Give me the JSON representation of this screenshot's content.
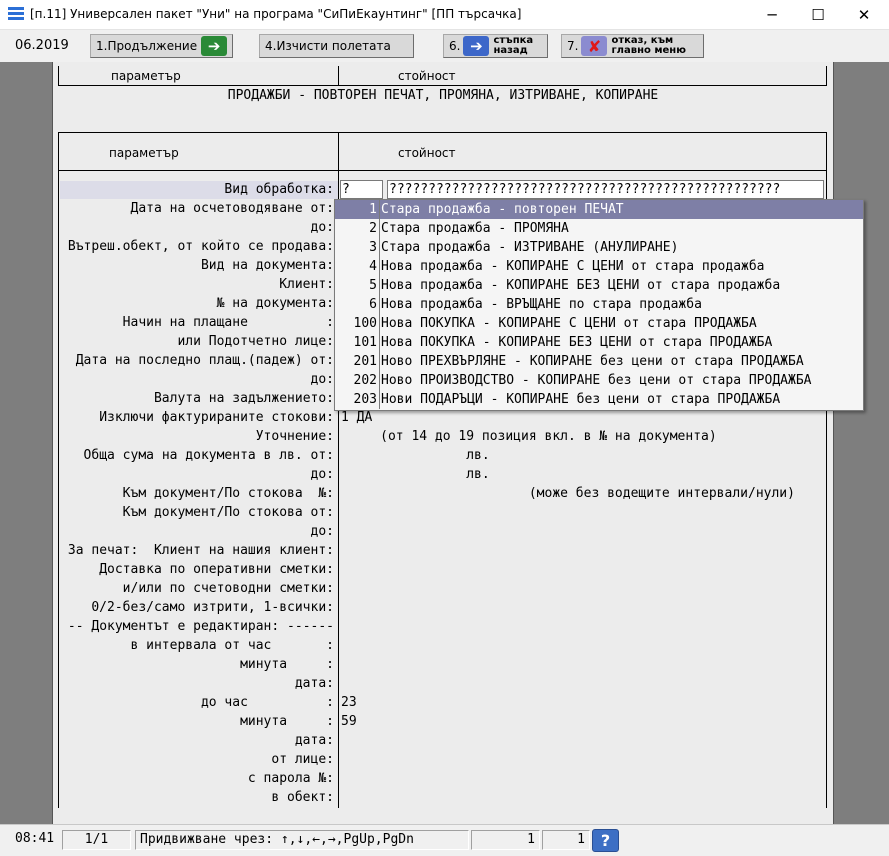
{
  "window": {
    "title": "[п.11] Универсален пакет \"Уни\" на програма \"СиПиЕкаунтинг\" [ПП търсачка]",
    "minimize": "─",
    "maximize": "☐",
    "close": "✕"
  },
  "toolbar": {
    "period": "06.2019",
    "continue_label": "1.Продължение",
    "clear_label": "4.Изчисти полетата",
    "back_label_num": "6.",
    "back_label_l1": "стъпка",
    "back_label_l2": "назад",
    "cancel_label_num": "7.",
    "cancel_label_l1": "отказ, към",
    "cancel_label_l2": "главно меню"
  },
  "grid": {
    "col_param": "параметър",
    "col_value": "стойност",
    "section_title": "ПРОДАЖБИ - ПОВТОРЕН ПЕЧАТ, ПРОМЯНА, ИЗТРИВАНЕ, КОПИРАНЕ"
  },
  "form": {
    "processing_type_label": "Вид обработка:",
    "processing_type_value": "?",
    "processing_type_hint": "??????????????????????????????????????????????????",
    "rows": [
      {
        "label": "Дата на осчетоводяване от:",
        "value": ""
      },
      {
        "label": "до:",
        "value": ""
      },
      {
        "label": "Вътреш.обект, от който се продава:",
        "value": ""
      },
      {
        "label": "Вид на документа:",
        "value": ""
      },
      {
        "label": "Клиент:",
        "value": ""
      },
      {
        "label": "№ на документа:",
        "value": ""
      },
      {
        "label": "Начин на плащане          :",
        "value": ""
      },
      {
        "label": "или Подотчетно лице:",
        "value": ""
      },
      {
        "label": "Дата на последно плащ.(падеж) от:",
        "value": ""
      },
      {
        "label": "до:",
        "value": ""
      },
      {
        "label": "Валута на задължението:",
        "value": ""
      },
      {
        "label": "Изключи фактурираните стокови:",
        "value": "1 ДА"
      },
      {
        "label": "Уточнение:",
        "value": "     (от 14 до 19 позиция вкл. в № на документа)"
      },
      {
        "label": "Обща сума на документа в лв. от:",
        "value": "                лв."
      },
      {
        "label": "до:",
        "value": "                лв."
      },
      {
        "label": "Към документ/По стокова  №:",
        "value": "                        (може без водещите интервали/нули)"
      },
      {
        "label": "Към документ/По стокова от:",
        "value": ""
      },
      {
        "label": "до:",
        "value": ""
      },
      {
        "label": "За печат:  Клиент на нашия клиент:",
        "value": ""
      },
      {
        "label": "Доставка по оперативни сметки:",
        "value": ""
      },
      {
        "label": "и/или по счетоводни сметки:",
        "value": ""
      },
      {
        "label": "0/2-без/само изтрити, 1-всички:",
        "value": ""
      },
      {
        "label": "-- Документът е редактиран: ------",
        "value": ""
      },
      {
        "label": "в интервала от час       :",
        "value": ""
      },
      {
        "label": "минута     :",
        "value": ""
      },
      {
        "label": "дата:",
        "value": ""
      },
      {
        "label": "до час          :",
        "value": "23"
      },
      {
        "label": "минута     :",
        "value": "59"
      },
      {
        "label": "дата:",
        "value": ""
      },
      {
        "label": "от лице:",
        "value": ""
      },
      {
        "label": "с парола №:",
        "value": ""
      },
      {
        "label": "в обект:",
        "value": ""
      }
    ]
  },
  "dropdown": {
    "selected_index": 0,
    "options": [
      {
        "code": "1",
        "text": "Стара продажба - повторен ПЕЧАТ"
      },
      {
        "code": "2",
        "text": "Стара продажба - ПРОМЯНА"
      },
      {
        "code": "3",
        "text": "Стара продажба - ИЗТРИВАНЕ (АНУЛИРАНЕ)"
      },
      {
        "code": "4",
        "text": "Нова продажба - КОПИРАНЕ С ЦЕНИ от стара продажба"
      },
      {
        "code": "5",
        "text": "Нова продажба - КОПИРАНЕ БЕЗ ЦЕНИ от стара продажба"
      },
      {
        "code": "6",
        "text": "Нова продажба - ВРЪЩАНЕ по стара продажба"
      },
      {
        "code": "100",
        "text": "Нова ПОКУПКА - КОПИРАНЕ С ЦЕНИ от стара ПРОДАЖБА"
      },
      {
        "code": "101",
        "text": "Нова ПОКУПКА - КОПИРАНЕ БЕЗ ЦЕНИ от стара ПРОДАЖБА"
      },
      {
        "code": "201",
        "text": "Ново ПРЕХВЪРЛЯНЕ - КОПИРАНЕ без цени от стара ПРОДАЖБА"
      },
      {
        "code": "202",
        "text": "Ново ПРОИЗВОДСТВО - КОПИРАНЕ без цени от стара ПРОДАЖБА"
      },
      {
        "code": "203",
        "text": "Нови ПОДАРЪЦИ - КОПИРАНЕ без цени от стара ПРОДАЖБА"
      }
    ]
  },
  "statusbar": {
    "time": "08:41",
    "page": "1/1",
    "nav_hint": "Придвижване чрез: ↑,↓,←,→,PgUp,PgDn",
    "field_a": "1",
    "field_b": "1",
    "help": "?"
  },
  "colors": {
    "selection": "#7e7fa6",
    "workspace": "#7e7e7e",
    "panel": "#ececec"
  }
}
